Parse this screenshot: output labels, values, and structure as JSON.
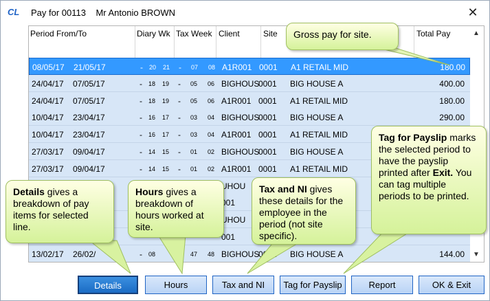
{
  "window": {
    "title": "Pay for 00113",
    "employee": "Mr Antonio BROWN",
    "app_icon": "CL"
  },
  "columns": {
    "period": "Period From/To",
    "diary_wk": "Diary Wk",
    "tax_week": "Tax Week",
    "client": "Client",
    "site": "Site",
    "total_pay": "Total Pay"
  },
  "rows": [
    {
      "from": "08/05/17",
      "to": "21/05/17",
      "dash1": "-",
      "d1": "20",
      "d2": "21",
      "dash2": "-",
      "t1": "07",
      "t2": "08",
      "client": "A1R001",
      "site": "0001",
      "site_name": "A1 RETAIL MID",
      "total": "180.00"
    },
    {
      "from": "24/04/17",
      "to": "07/05/17",
      "dash1": "-",
      "d1": "18",
      "d2": "19",
      "dash2": "-",
      "t1": "05",
      "t2": "06",
      "client": "BIGHOUS",
      "site": "0001",
      "site_name": "BIG HOUSE A",
      "total": "400.00"
    },
    {
      "from": "24/04/17",
      "to": "07/05/17",
      "dash1": "-",
      "d1": "18",
      "d2": "19",
      "dash2": "-",
      "t1": "05",
      "t2": "06",
      "client": "A1R001",
      "site": "0001",
      "site_name": "A1 RETAIL MID",
      "total": "180.00"
    },
    {
      "from": "10/04/17",
      "to": "23/04/17",
      "dash1": "-",
      "d1": "16",
      "d2": "17",
      "dash2": "-",
      "t1": "03",
      "t2": "04",
      "client": "BIGHOUS",
      "site": "0001",
      "site_name": "BIG HOUSE A",
      "total": "290.00"
    },
    {
      "from": "10/04/17",
      "to": "23/04/17",
      "dash1": "-",
      "d1": "16",
      "d2": "17",
      "dash2": "-",
      "t1": "03",
      "t2": "04",
      "client": "A1R001",
      "site": "0001",
      "site_name": "A1 RETAIL MID",
      "total": ""
    },
    {
      "from": "27/03/17",
      "to": "09/04/17",
      "dash1": "-",
      "d1": "14",
      "d2": "15",
      "dash2": "-",
      "t1": "01",
      "t2": "02",
      "client": "BIGHOUS",
      "site": "0001",
      "site_name": "BIG HOUSE A",
      "total": ""
    },
    {
      "from": "27/03/17",
      "to": "09/04/17",
      "dash1": "-",
      "d1": "14",
      "d2": "15",
      "dash2": "-",
      "t1": "01",
      "t2": "02",
      "client": "A1R001",
      "site": "0001",
      "site_name": "A1 RETAIL MID",
      "total": ""
    },
    {
      "from": "",
      "to": "",
      "dash1": "",
      "d1": "",
      "d2": "",
      "dash2": "",
      "t1": "",
      "t2": "",
      "client": "UHOU",
      "site": "",
      "site_name": "",
      "total": ""
    },
    {
      "from": "",
      "to": "",
      "dash1": "",
      "d1": "",
      "d2": "",
      "dash2": "",
      "t1": "",
      "t2": "",
      "client": "001",
      "site": "",
      "site_name": "",
      "total": ""
    },
    {
      "from": "",
      "to": "",
      "dash1": "",
      "d1": "",
      "d2": "",
      "dash2": "",
      "t1": "",
      "t2": "",
      "client": "UHOU",
      "site": "",
      "site_name": "",
      "total": ""
    },
    {
      "from": "",
      "to": "",
      "dash1": "",
      "d1": "",
      "d2": "",
      "dash2": "",
      "t1": "",
      "t2": "",
      "client": "001",
      "site": "",
      "site_name": "",
      "total": ""
    },
    {
      "from": "13/02/17",
      "to": "26/02/",
      "dash1": "-",
      "d1": "08",
      "d2": "",
      "dash2": "-",
      "t1": "47",
      "t2": "48",
      "client": "BIGHOUS",
      "site": "0001",
      "site_name": "BIG HOUSE A",
      "total": "144.00"
    }
  ],
  "buttons": {
    "details": "Details",
    "hours": "Hours",
    "tax_ni": "Tax and NI",
    "tag_payslip": "Tag for Payslip",
    "report": "Report",
    "ok_exit": "OK & Exit"
  },
  "callouts": {
    "gross": "Gross pay for site.",
    "details_bold": "Details",
    "details_text": " gives a breakdown of pay items for selected line.",
    "hours_bold": "Hours",
    "hours_text": " gives a breakdown of hours worked at site.",
    "tax_bold": "Tax and NI",
    "tax_text": " gives these details for the employee in the period (not site specific).",
    "tag_bold": "Tag for Payslip",
    "tag_text1": " marks the selected period to have the payslip printed after ",
    "tag_exit": "Exit.",
    "tag_text2": " You can tag multiple periods to be printed."
  },
  "colors": {
    "selected_row": "#3399ff",
    "row": "#d7e6f7",
    "callout": "#d5f29a",
    "accent": "#1f63c6"
  }
}
